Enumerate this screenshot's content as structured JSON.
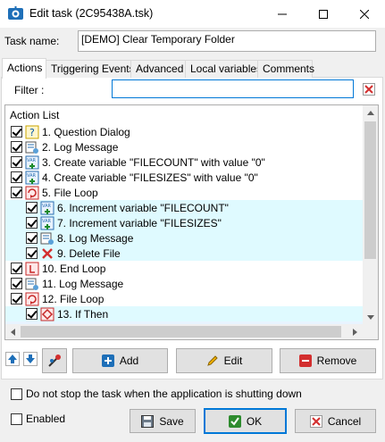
{
  "window": {
    "title": "Edit task (2C95438A.tsk)",
    "icon": "gear-app-icon"
  },
  "task_name": {
    "label": "Task name:",
    "value": "[DEMO] Clear Temporary Folder"
  },
  "tabs": [
    {
      "label": "Actions",
      "active": true
    },
    {
      "label": "Triggering Events"
    },
    {
      "label": "Advanced"
    },
    {
      "label": "Local variables"
    },
    {
      "label": "Comments"
    }
  ],
  "filter": {
    "label": "Filter :",
    "value": ""
  },
  "action_list": {
    "header": "Action List",
    "rows": [
      {
        "text": "1. Question Dialog",
        "checked": true,
        "icon": "question-icon"
      },
      {
        "text": "2. Log Message",
        "checked": true,
        "icon": "log-icon"
      },
      {
        "text": "3. Create variable \"FILECOUNT\" with value \"0\"",
        "checked": true,
        "icon": "variable-icon"
      },
      {
        "text": "4. Create variable \"FILESIZES\" with value \"0\"",
        "checked": true,
        "icon": "variable-icon"
      },
      {
        "text": "5. File Loop",
        "checked": true,
        "icon": "loop-icon"
      },
      {
        "text": "6. Increment variable \"FILECOUNT\"",
        "checked": true,
        "icon": "variable-icon"
      },
      {
        "text": "7. Increment variable \"FILESIZES\"",
        "checked": true,
        "icon": "variable-icon"
      },
      {
        "text": "8. Log Message",
        "checked": true,
        "icon": "log-icon"
      },
      {
        "text": "9. Delete File",
        "checked": true,
        "icon": "delete-icon"
      },
      {
        "text": "10. End Loop",
        "checked": true,
        "icon": "end-loop-icon"
      },
      {
        "text": "11. Log Message",
        "checked": true,
        "icon": "log-icon"
      },
      {
        "text": "12. File Loop",
        "checked": true,
        "icon": "loop-icon"
      },
      {
        "text": "13. If Then",
        "checked": true,
        "icon": "if-icon"
      }
    ]
  },
  "buttons": {
    "add": "Add",
    "edit": "Edit",
    "remove": "Remove",
    "save": "Save",
    "ok": "OK",
    "cancel": "Cancel"
  },
  "options": {
    "do_not_stop": "Do not stop the task when the application is shutting down",
    "enabled": "Enabled"
  },
  "colors": {
    "accent": "#0078d7",
    "nested_row": "#dffaff",
    "close_red": "#d32f2f"
  }
}
